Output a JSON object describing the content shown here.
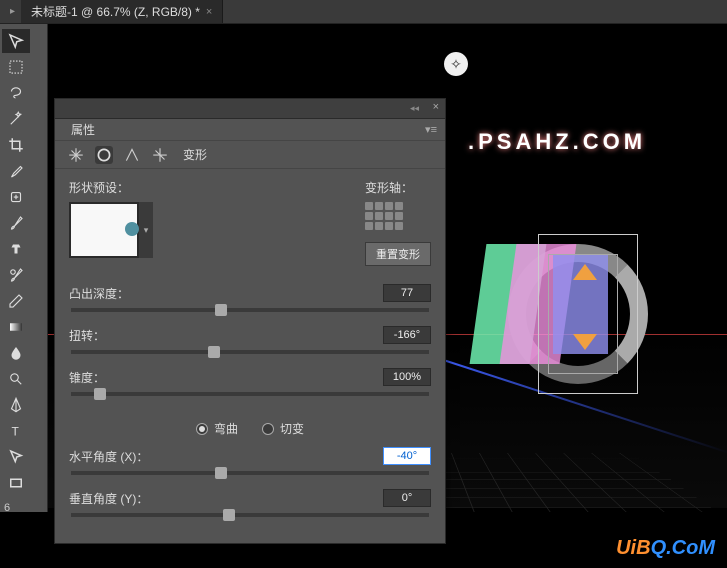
{
  "tab": {
    "title": "未标题-1 @ 66.7% (Z, RGB/8) *"
  },
  "zoom_readout": "6",
  "canvas": {
    "site_text": ".PSAHZ.COM"
  },
  "panel": {
    "title": "属性",
    "mode_label": "变形",
    "preset_label": "形状预设：",
    "axis_label": "变形轴：",
    "reset_btn": "重置变形",
    "sliders": {
      "extrude": {
        "label": "凸出深度：",
        "value": "77",
        "pos": 42
      },
      "twist": {
        "label": "扭转：",
        "value": "-166°",
        "pos": 40
      },
      "taper": {
        "label": "锥度：",
        "value": "100%",
        "pos": 8
      },
      "hangle": {
        "label": "水平角度 (X)：",
        "value": "-40°",
        "pos": 42
      },
      "vangle": {
        "label": "垂直角度 (Y)：",
        "value": "0°",
        "pos": 44
      }
    },
    "radios": {
      "bend": "弯曲",
      "shear": "切变"
    }
  },
  "watermark": {
    "a": "UiB",
    "b": "Q.CoM"
  }
}
